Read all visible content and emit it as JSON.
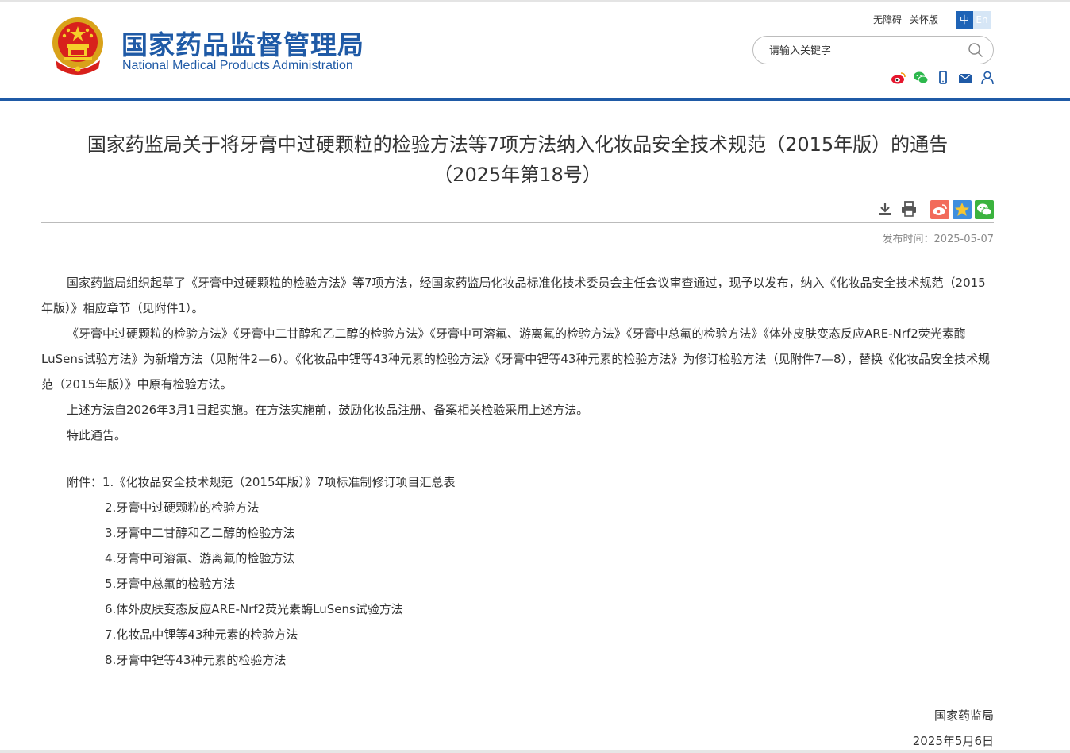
{
  "header": {
    "site_name_cn": "国家药品监督管理局",
    "site_name_en": "National Medical Products Administration",
    "top_links": [
      "无障碍",
      "关怀版"
    ],
    "lang_cn": "中",
    "lang_en": "En",
    "search_placeholder": "请输入关键字",
    "brand_color": "#1f5aa6",
    "social_icons": [
      "weibo-icon",
      "wechat-icon",
      "mobile-icon",
      "mail-icon",
      "user-icon"
    ]
  },
  "article": {
    "title_line1": "国家药监局关于将牙膏中过硬颗粒的检验方法等7项方法纳入化妆品安全技术规范（2015年版）的通告",
    "title_line2": "（2025年第18号）",
    "publish_date": "发布时间：2025-05-07",
    "tool_icons": [
      "download-icon",
      "print-icon",
      "share-weibo-icon",
      "share-qzone-icon",
      "share-wechat-icon"
    ],
    "paragraphs": [
      "国家药监局组织起草了《牙膏中过硬颗粒的检验方法》等7项方法，经国家药监局化妆品标准化技术委员会主任会议审查通过，现予以发布，纳入《化妆品安全技术规范（2015年版）》相应章节（见附件1）。",
      "《牙膏中过硬颗粒的检验方法》《牙膏中二甘醇和乙二醇的检验方法》《牙膏中可溶氟、游离氟的检验方法》《牙膏中总氟的检验方法》《体外皮肤变态反应ARE-Nrf2荧光素酶LuSens试验方法》为新增方法（见附件2—6）。《化妆品中锂等43种元素的检验方法》《牙膏中锂等43种元素的检验方法》为修订检验方法（见附件7—8），替换《化妆品安全技术规范（2015年版）》中原有检验方法。",
      "上述方法自2026年3月1日起实施。在方法实施前，鼓励化妆品注册、备案相关检验采用上述方法。",
      "特此通告。"
    ],
    "attachments_label": "附件：",
    "attachments": [
      "1.《化妆品安全技术规范（2015年版）》7项标准制修订项目汇总表",
      "2.牙膏中过硬颗粒的检验方法",
      "3.牙膏中二甘醇和乙二醇的检验方法",
      "4.牙膏中可溶氟、游离氟的检验方法",
      "5.牙膏中总氟的检验方法",
      "6.体外皮肤变态反应ARE-Nrf2荧光素酶LuSens试验方法",
      "7.化妆品中锂等43种元素的检验方法",
      "8.牙膏中锂等43种元素的检验方法"
    ],
    "signature_org": "国家药监局",
    "signature_date": "2025年5月6日"
  }
}
